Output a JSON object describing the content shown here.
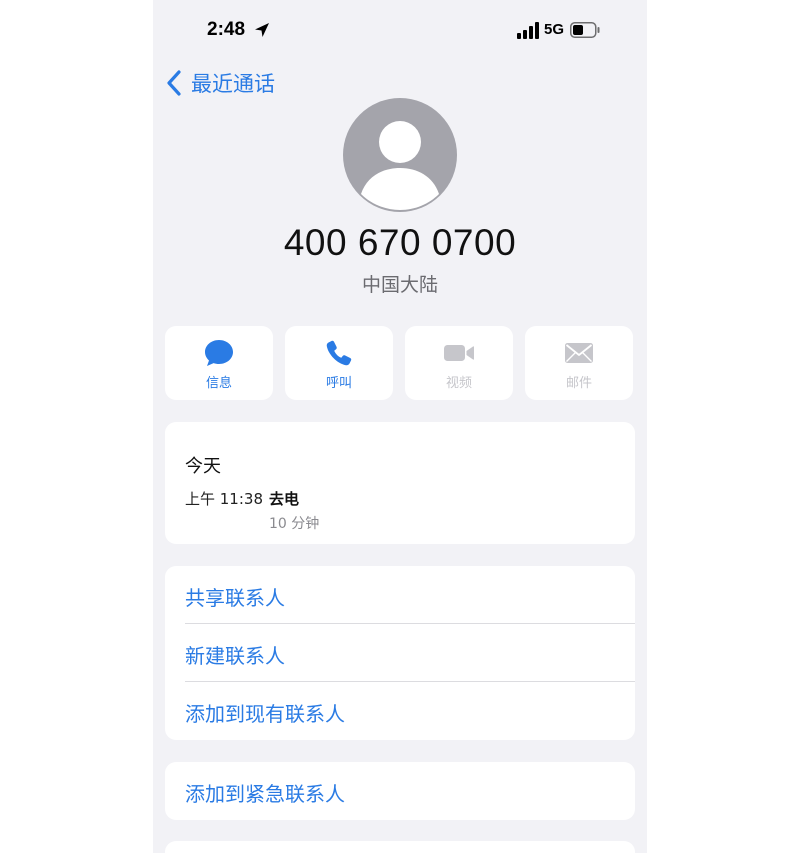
{
  "status_bar": {
    "time": "2:48",
    "network": "5G",
    "icons": [
      "location-arrow-icon",
      "signal-bars-icon",
      "battery-icon"
    ]
  },
  "nav": {
    "back_label": "最近通话",
    "back_icon": "chevron-left-icon"
  },
  "contact": {
    "avatar_icon": "person-silhouette-icon",
    "number": "400 670 0700",
    "region": "中国大陆"
  },
  "actions": [
    {
      "label": "信息",
      "icon": "message-bubble-icon",
      "enabled": true
    },
    {
      "label": "呼叫",
      "icon": "phone-icon",
      "enabled": true
    },
    {
      "label": "视频",
      "icon": "video-camera-icon",
      "enabled": false
    },
    {
      "label": "邮件",
      "icon": "envelope-icon",
      "enabled": false
    }
  ],
  "recents": {
    "day": "今天",
    "time": "上午 11:38",
    "type": "去电",
    "duration": "10 分钟"
  },
  "menu": {
    "items": [
      "共享联系人",
      "新建联系人",
      "添加到现有联系人"
    ],
    "emergency": "添加到紧急联系人"
  },
  "colors": {
    "accent": "#2a7be4",
    "background": "#f2f2f6",
    "disabled": "#c6c6cb",
    "avatar": "#a4a4ab"
  }
}
